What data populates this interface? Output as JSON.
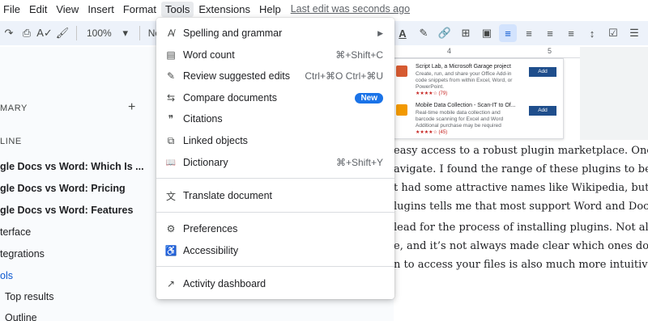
{
  "menubar": {
    "items": [
      "File",
      "Edit",
      "View",
      "Insert",
      "Format",
      "Tools",
      "Extensions",
      "Help"
    ],
    "last_edit": "Last edit was seconds ago"
  },
  "toolbar": {
    "zoom": "100%",
    "style": "Normal"
  },
  "sidebar": {
    "summary": "MARY",
    "outline": "LINE",
    "items": [
      "gle Docs vs Word: Which Is ...",
      "gle Docs vs Word: Pricing",
      "gle Docs vs Word: Features",
      "terface",
      "tegrations",
      "ols",
      "Top results",
      "Outline"
    ]
  },
  "ruler": {
    "marks": [
      "4",
      "5"
    ]
  },
  "plugins": [
    {
      "title": "Script Lab, a Microsoft Garage project",
      "desc": "Create, run, and share your Office Add-in code snippets from within Excel, Word, or PowerPoint.",
      "rating": "★★★★☆ (79)",
      "add": "Add"
    },
    {
      "title": "Mobile Data Collection - Scan-IT to Of...",
      "desc": "Real-time mobile data collection and barcode scanning for Excel and Word",
      "extra": "Additional purchase may be required",
      "rating": "★★★★☆ (45)",
      "add": "Add"
    }
  ],
  "body_lines": [
    "easy access to a robust plugin marketplace. Once",
    "avigate. I found the range of these plugins to be",
    "t had some attractive names like Wikipedia, but",
    "lugins tells me that most support Word and Docs.",
    "lead for the process of installing plugins. Not all",
    "e, and it’s not always made clear which ones do.",
    "n to access your files is also much more intuitive"
  ],
  "tools_menu": {
    "items": [
      {
        "label": "Spelling and grammar",
        "icon": "spellcheck-icon",
        "glyph": "A̸",
        "arrow": "▶"
      },
      {
        "label": "Word count",
        "icon": "word-count-icon",
        "glyph": "▤",
        "shortcut": "⌘+Shift+C"
      },
      {
        "label": "Review suggested edits",
        "icon": "review-edits-icon",
        "glyph": "✎",
        "shortcut": "Ctrl+⌘O Ctrl+⌘U"
      },
      {
        "label": "Compare documents",
        "icon": "compare-icon",
        "glyph": "⇆",
        "badge": "New"
      },
      {
        "label": "Citations",
        "icon": "citations-icon",
        "glyph": "❞"
      },
      {
        "label": "Linked objects",
        "icon": "linked-objects-icon",
        "glyph": "⧉"
      },
      {
        "label": "Dictionary",
        "icon": "dictionary-icon",
        "glyph": "📖",
        "shortcut": "⌘+Shift+Y"
      },
      {
        "label": "Translate document",
        "icon": "translate-icon",
        "glyph": "文"
      },
      {
        "label": "Preferences",
        "icon": "preferences-icon",
        "glyph": "⚙"
      },
      {
        "label": "Accessibility",
        "icon": "accessibility-icon",
        "glyph": "♿"
      },
      {
        "label": "Activity dashboard",
        "icon": "activity-dashboard-icon",
        "glyph": "↗"
      }
    ]
  },
  "colors": {
    "accent": "#1a73e8",
    "toolbar_bg": "#edf2fa",
    "sidebar_link": "#0b57d0"
  }
}
